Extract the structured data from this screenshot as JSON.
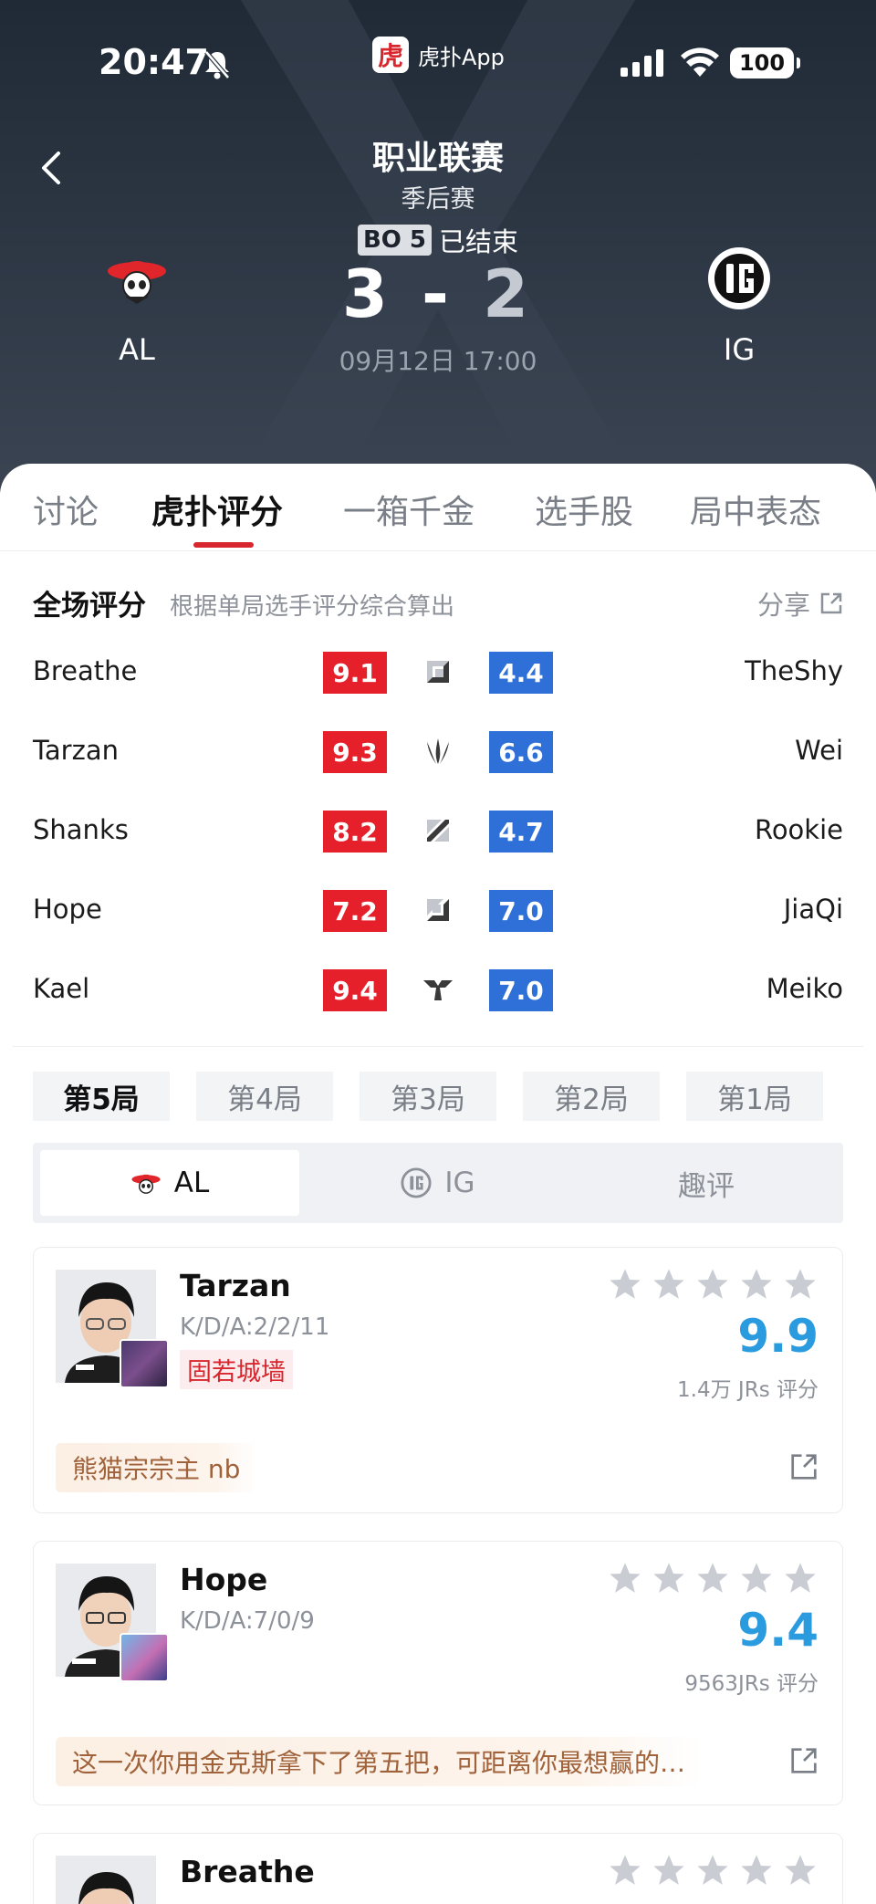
{
  "status_bar": {
    "time": "20:47",
    "app_name": "虎扑App",
    "app_logo_char": "虎",
    "battery": "100"
  },
  "match": {
    "league": "职业联赛",
    "stage": "季后赛",
    "bo_tag": "BO 5",
    "state": "已结束",
    "home_score": "3",
    "sep": "-",
    "away_score": "2",
    "datetime": "09月12日 17:00",
    "home_team": "AL",
    "away_team": "IG"
  },
  "tabs": [
    "讨论",
    "虎扑评分",
    "一箱千金",
    "选手股",
    "局中表态"
  ],
  "summary": {
    "title": "全场评分",
    "subtitle": "根据单局选手评分综合算出",
    "share": "分享"
  },
  "ratings": [
    {
      "left": "Breathe",
      "left_score": "9.1",
      "role": "top-icon",
      "right_score": "4.4",
      "right": "TheShy"
    },
    {
      "left": "Tarzan",
      "left_score": "9.3",
      "role": "jungle-icon",
      "right_score": "6.6",
      "right": "Wei"
    },
    {
      "left": "Shanks",
      "left_score": "8.2",
      "role": "mid-icon",
      "right_score": "4.7",
      "right": "Rookie"
    },
    {
      "left": "Hope",
      "left_score": "7.2",
      "role": "bot-icon",
      "right_score": "7.0",
      "right": "JiaQi"
    },
    {
      "left": "Kael",
      "left_score": "9.4",
      "role": "support-icon",
      "right_score": "7.0",
      "right": "Meiko"
    }
  ],
  "games": [
    "第5局",
    "第4局",
    "第3局",
    "第2局",
    "第1局"
  ],
  "segments": [
    "AL",
    "IG",
    "趣评"
  ],
  "cards": [
    {
      "name": "Tarzan",
      "kda": "K/D/A:2/2/11",
      "badge": "固若城墙",
      "score": "9.9",
      "votes": "1.4万 JRs 评分",
      "comment": "熊猫宗宗主 nb"
    },
    {
      "name": "Hope",
      "kda": "K/D/A:7/0/9",
      "badge": "",
      "score": "9.4",
      "votes": "9563JRs 评分",
      "comment": "这一次你用金克斯拿下了第五把，可距离你最想赢的…"
    },
    {
      "name": "Breathe",
      "kda": "",
      "badge": "",
      "score": "",
      "votes": "",
      "comment": ""
    }
  ],
  "colors": {
    "accent_red": "#d7262d",
    "home_score_red": "#e6202a",
    "away_score_blue": "#2f6fd8",
    "rating_blue": "#2b9be0"
  }
}
